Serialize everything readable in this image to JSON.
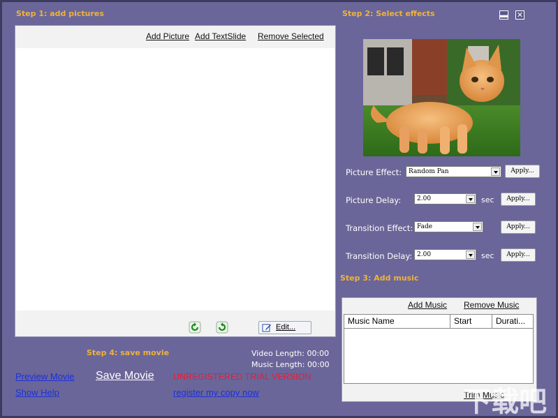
{
  "window": {
    "minimize_icon": "minimize-icon",
    "close_icon": "close-icon",
    "minimize_glyph": "▬",
    "close_glyph": "✕",
    "bg_color": "#6a6699",
    "accent_color": "#f0b23a"
  },
  "step1": {
    "title": "Step 1: add pictures",
    "add_picture": "Add Picture",
    "add_textslide": "Add TextSlide",
    "remove_selected": "Remove Selected",
    "rotate_left_icon": "rotate-left-icon",
    "rotate_right_icon": "rotate-right-icon",
    "edit_label": "Edit..."
  },
  "step2": {
    "title": "Step 2: Select effects",
    "preview_image": "kitten-photo",
    "picture_effect_label": "Picture Effect:",
    "picture_effect_value": "Random Pan",
    "picture_delay_label": "Picture Delay:",
    "picture_delay_value": "2.00",
    "transition_effect_label": "Transition Effect:",
    "transition_effect_value": "Fade",
    "transition_delay_label": "Transition Delay:",
    "transition_delay_value": "2.00",
    "sec_label": "sec",
    "apply_label": "Apply..."
  },
  "step3": {
    "title": "Step 3: Add music",
    "add_music": "Add Music",
    "remove_music": "Remove Music",
    "columns": [
      "Music Name",
      "Start",
      "Durati..."
    ],
    "trim_music": "Trim Music"
  },
  "step4": {
    "title": "Step 4: save movie",
    "video_length_label": "Video Length: 00:00",
    "music_length_label": "Music Length: 00:00",
    "preview_movie": "Preview Movie",
    "save_movie": "Save Movie",
    "trial_text": "UNREGISTERED TRIAL VERSION",
    "show_help": "Show Help",
    "register": "register my copy now"
  },
  "watermark": "下载吧"
}
